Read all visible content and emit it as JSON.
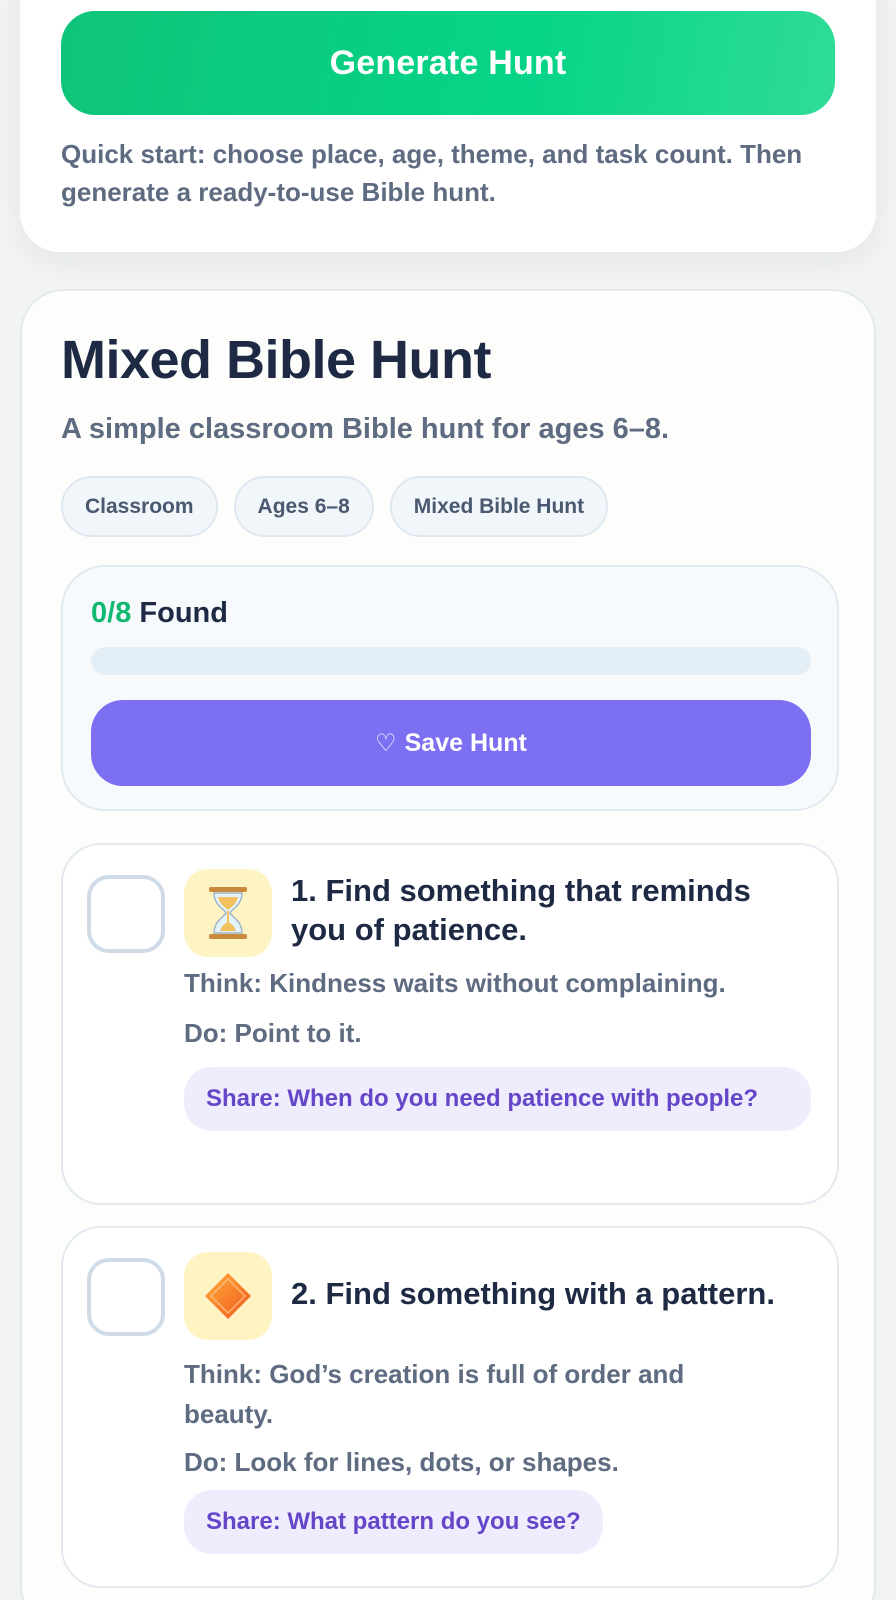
{
  "generator": {
    "button_label": "Generate Hunt",
    "hint": "Quick start: choose place, age, theme, and task count. Then generate a ready-to-use Bible hunt."
  },
  "hunt": {
    "title": "Mixed Bible Hunt",
    "subtitle": "A simple classroom Bible hunt for ages 6–8.",
    "tags": [
      "Classroom",
      "Ages 6–8",
      "Mixed Bible Hunt"
    ],
    "progress": {
      "found": "0",
      "slash": "/",
      "total": "8",
      "label": " Found",
      "fraction": 0
    },
    "save_label": "Save Hunt",
    "save_icon": "♡",
    "tasks": [
      {
        "title": "1. Find something that reminds you of patience.",
        "icon": "hourglass-icon",
        "emoji": "⏳",
        "think": "Think: Kindness waits without complaining.",
        "do": "Do: Point to it.",
        "share": "Share: When do you need patience with people?"
      },
      {
        "title": "2. Find something with a pattern.",
        "icon": "diamond-icon",
        "emoji": "🔶",
        "think": "Think: God’s creation is full of order and beauty.",
        "do": "Do: Look for lines, dots, or shapes.",
        "share": "Share: What pattern do you see?"
      }
    ]
  },
  "colors": {
    "green": "#10b870",
    "purple": "#7c6ff2",
    "navy": "#1e2a44",
    "slate": "#5e6b80"
  }
}
